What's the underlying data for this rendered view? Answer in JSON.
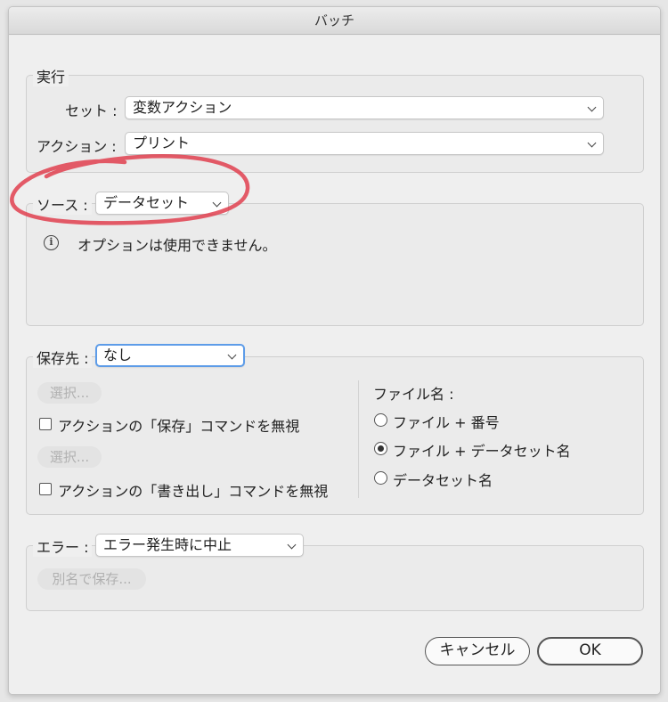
{
  "window": {
    "title": "バッチ"
  },
  "play": {
    "title": "実行",
    "set_label": "セット :",
    "set_value": "変数アクション",
    "action_label": "アクション :",
    "action_value": "プリント"
  },
  "source": {
    "label": "ソース :",
    "value": "データセット",
    "info_text": "オプションは使用できません。",
    "info_icon": "info-icon",
    "annotation_color": "#e0404f"
  },
  "destination": {
    "label": "保存先 :",
    "value": "なし",
    "choose_button_1": "選択...",
    "override_save": "アクションの「保存」コマンドを無視",
    "choose_button_2": "選択...",
    "override_export": "アクションの「書き出し」コマンドを無視",
    "file_name_label": "ファイル名 :",
    "file_name_options": [
      {
        "label": "ファイル + 番号",
        "selected": false
      },
      {
        "label": "ファイル + データセット名",
        "selected": true
      },
      {
        "label": "データセット名",
        "selected": false
      }
    ]
  },
  "errors": {
    "label": "エラー :",
    "value": "エラー発生時に中止",
    "save_as_button": "別名で保存..."
  },
  "footer": {
    "cancel": "キャンセル",
    "ok": "OK"
  }
}
